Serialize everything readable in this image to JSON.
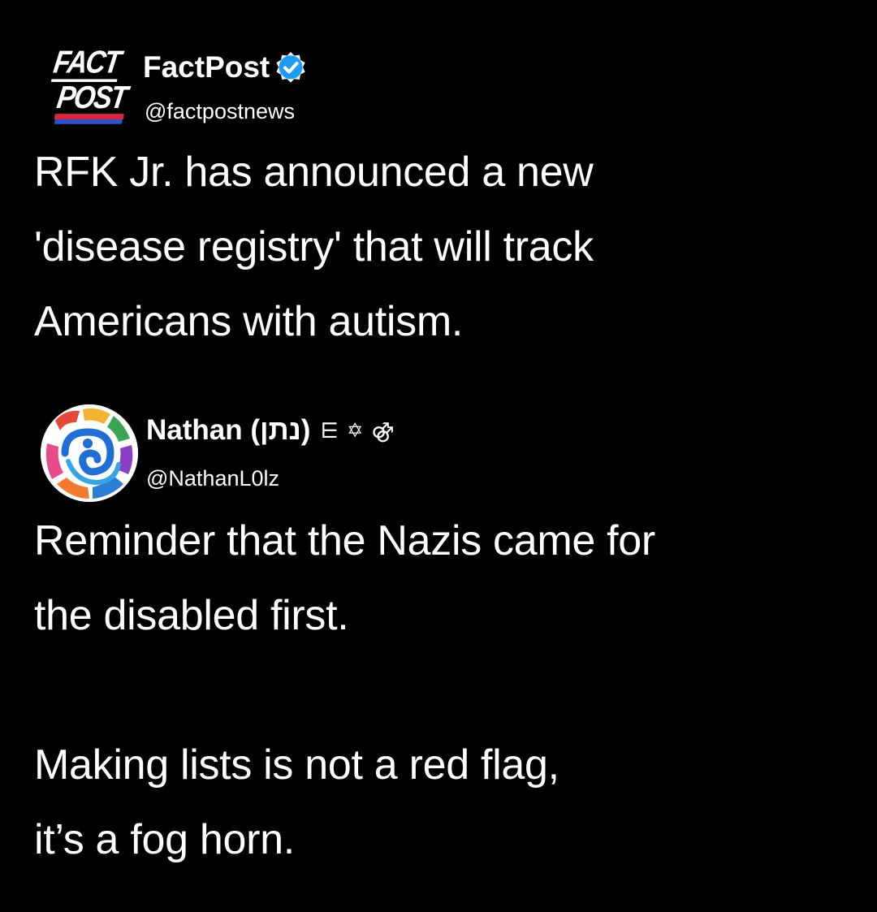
{
  "posts": [
    {
      "author": {
        "display_name": "FactPost",
        "handle": "@factpostnews",
        "verified": true,
        "verified_icon": "verified-checkmark-icon",
        "avatar": {
          "type": "logo",
          "line1": "FACT",
          "line2": "POST"
        }
      },
      "text": "RFK Jr. has announced a new\n'disease registry' that will track\nAmericans with autism."
    },
    {
      "author": {
        "display_name": "Nathan (נתן)",
        "handle": "@NathanL0lz",
        "name_emojis": [
          "⋿",
          "✡",
          "⚣"
        ],
        "avatar": {
          "type": "image",
          "icon": "colorful-profile-avatar-icon"
        }
      },
      "text": "Reminder that the Nazis came for\nthe disabled first.\n\nMaking lists is not a red flag,\nit’s a fog horn."
    }
  ],
  "colors": {
    "background": "#000000",
    "text": "#ffffff",
    "verified_blue": "#1d9bf0",
    "logo_red": "#d7263d",
    "logo_blue": "#2b54c8"
  }
}
